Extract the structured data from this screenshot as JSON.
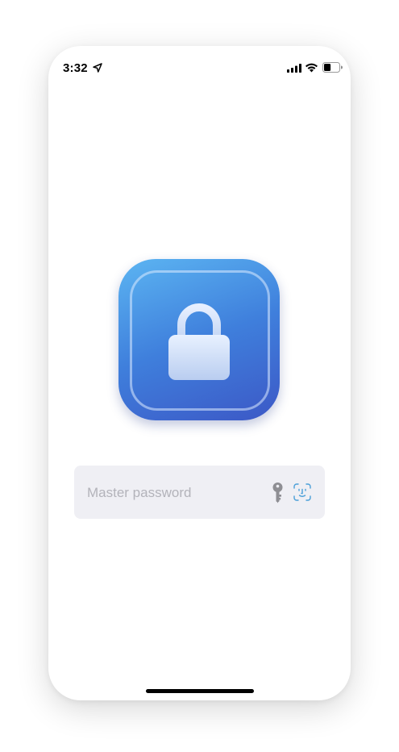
{
  "status_bar": {
    "time": "3:32",
    "location_icon": "location-arrow-icon",
    "signal_icon": "cellular-signal-icon",
    "wifi_icon": "wifi-icon",
    "battery_icon": "battery-icon",
    "battery_level": 0.45
  },
  "app_icon": {
    "glyph": "padlock-icon",
    "colors": {
      "gradient_top": "#5cb5f2",
      "gradient_bottom": "#3c58c6"
    }
  },
  "password_field": {
    "placeholder": "Master password",
    "value": "",
    "key_icon": "key-icon",
    "faceid_icon": "face-id-icon",
    "faceid_color": "#4a9fd8"
  }
}
